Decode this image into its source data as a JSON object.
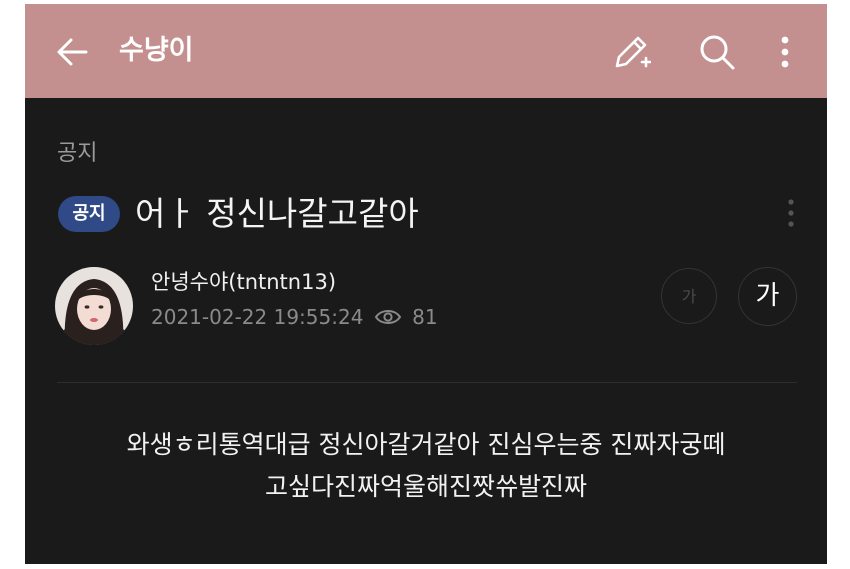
{
  "appbar": {
    "title": "수냥이",
    "back_icon": "arrow-left-icon",
    "edit_icon": "pencil-plus-icon",
    "search_icon": "search-icon",
    "more_icon": "more-vertical-icon",
    "color": "#c48f8f"
  },
  "post": {
    "category": "공지",
    "badge": "공지",
    "title": "어ㅏ 정신나갈고같아",
    "author": "안녕수야(tntntn13)",
    "datetime": "2021-02-22 19:55:24",
    "views": "81",
    "font_small_label": "가",
    "font_large_label": "가",
    "body_line1": "와생ㅎ리통역대급 정신아갈거같아 진심우는중 진짜자궁떼",
    "body_line2": "고싶다진짜억울해진짯쓔발진짜"
  },
  "colors": {
    "background": "#1a1a1a",
    "badge": "#2f4a86"
  }
}
